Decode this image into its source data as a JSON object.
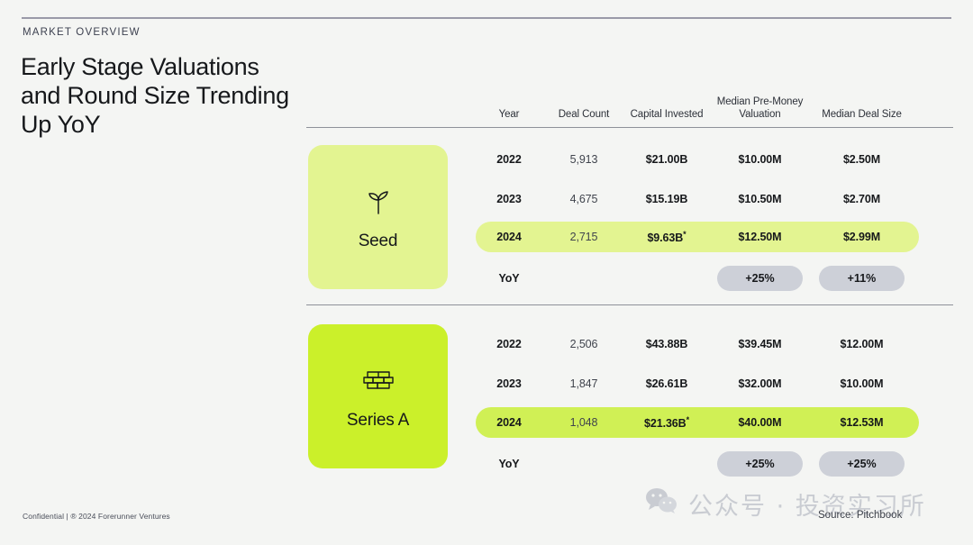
{
  "eyebrow": "MARKET OVERVIEW",
  "headline": "Early Stage Valuations and Round Size Trending Up YoY",
  "footer_note": "Confidential | ® 2024 Forerunner Ventures",
  "source_note": "Source: Pitchbook",
  "watermark": "公众号 · 投资实习所",
  "colors": {
    "background": "#f4f5f3",
    "seed_card": "#e3f491",
    "series_a_card": "#cbf02a",
    "seed_highlight": "#e3f491",
    "series_a_highlight": "#d0f055",
    "pill": "#cdd0d8",
    "rule": "#9a9aa8"
  },
  "table": {
    "headers": {
      "year": "Year",
      "deal_count": "Deal Count",
      "capital_invested": "Capital Invested",
      "median_pre_money": "Median Pre-Money Valuation",
      "median_deal_size": "Median Deal Size"
    },
    "yoy_label": "YoY"
  },
  "sections": [
    {
      "name": "Seed",
      "icon": "sprout-icon",
      "rows": [
        {
          "year": "2022",
          "deal_count": "5,913",
          "capital_invested": "$21.00B",
          "median_pre_money": "$10.00M",
          "median_deal_size": "$2.50M"
        },
        {
          "year": "2023",
          "deal_count": "4,675",
          "capital_invested": "$15.19B",
          "median_pre_money": "$10.50M",
          "median_deal_size": "$2.70M"
        },
        {
          "year": "2024",
          "deal_count": "2,715",
          "capital_invested": "$9.63B",
          "capital_invested_star": "*",
          "median_pre_money": "$12.50M",
          "median_deal_size": "$2.99M"
        }
      ],
      "yoy": {
        "median_pre_money": "+25%",
        "median_deal_size": "+11%"
      }
    },
    {
      "name": "Series A",
      "icon": "brick-wall-icon",
      "rows": [
        {
          "year": "2022",
          "deal_count": "2,506",
          "capital_invested": "$43.88B",
          "median_pre_money": "$39.45M",
          "median_deal_size": "$12.00M"
        },
        {
          "year": "2023",
          "deal_count": "1,847",
          "capital_invested": "$26.61B",
          "median_pre_money": "$32.00M",
          "median_deal_size": "$10.00M"
        },
        {
          "year": "2024",
          "deal_count": "1,048",
          "capital_invested": "$21.36B",
          "capital_invested_star": "*",
          "median_pre_money": "$40.00M",
          "median_deal_size": "$12.53M"
        }
      ],
      "yoy": {
        "median_pre_money": "+25%",
        "median_deal_size": "+25%"
      }
    }
  ],
  "chart_data": {
    "type": "table",
    "title": "Early Stage Valuations and Round Size Trending Up YoY",
    "columns": [
      "Year",
      "Deal Count",
      "Capital Invested",
      "Median Pre-Money Valuation",
      "Median Deal Size"
    ],
    "groups": [
      {
        "name": "Seed",
        "rows": [
          [
            "2022",
            5913,
            "$21.00B",
            "$10.00M",
            "$2.50M"
          ],
          [
            "2023",
            4675,
            "$15.19B",
            "$10.50M",
            "$2.70M"
          ],
          [
            "2024",
            2715,
            "$9.63B *",
            "$12.50M",
            "$2.99M"
          ]
        ],
        "yoy": {
          "Median Pre-Money Valuation": "+25%",
          "Median Deal Size": "+11%"
        }
      },
      {
        "name": "Series A",
        "rows": [
          [
            "2022",
            2506,
            "$43.88B",
            "$39.45M",
            "$12.00M"
          ],
          [
            "2023",
            1847,
            "$26.61B",
            "$32.00M",
            "$10.00M"
          ],
          [
            "2024",
            1048,
            "$21.36B *",
            "$40.00M",
            "$12.53M"
          ]
        ],
        "yoy": {
          "Median Pre-Money Valuation": "+25%",
          "Median Deal Size": "+25%"
        }
      }
    ],
    "source": "Source: Pitchbook"
  }
}
